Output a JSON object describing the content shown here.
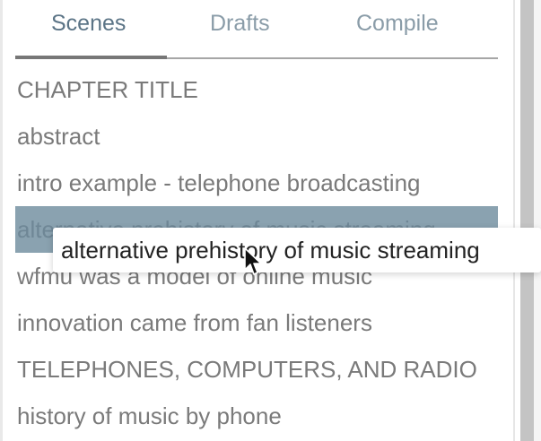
{
  "tabs": [
    {
      "label": "Scenes",
      "active": true
    },
    {
      "label": "Drafts",
      "active": false
    },
    {
      "label": "Compile",
      "active": false
    }
  ],
  "scenes": [
    {
      "label": "CHAPTER TITLE"
    },
    {
      "label": "abstract"
    },
    {
      "label": "intro example - telephone broadcasting"
    },
    {
      "label": "alternative prehistory of music streaming",
      "selected": true
    },
    {
      "label": "wfmu was a model of online music"
    },
    {
      "label": "innovation came from fan listeners"
    },
    {
      "label": "TELEPHONES, COMPUTERS, AND RADIO"
    },
    {
      "label": "history of music by phone"
    }
  ],
  "tooltip": {
    "text": "alternative prehistory of music streaming"
  },
  "colors": {
    "selected_row": "#8aa2b0",
    "active_tab": "#5b7486",
    "inactive_tab": "#8a9ca8",
    "item_text": "#7a7a7a"
  },
  "icons": {
    "pointer": "arrow-cursor-icon"
  }
}
